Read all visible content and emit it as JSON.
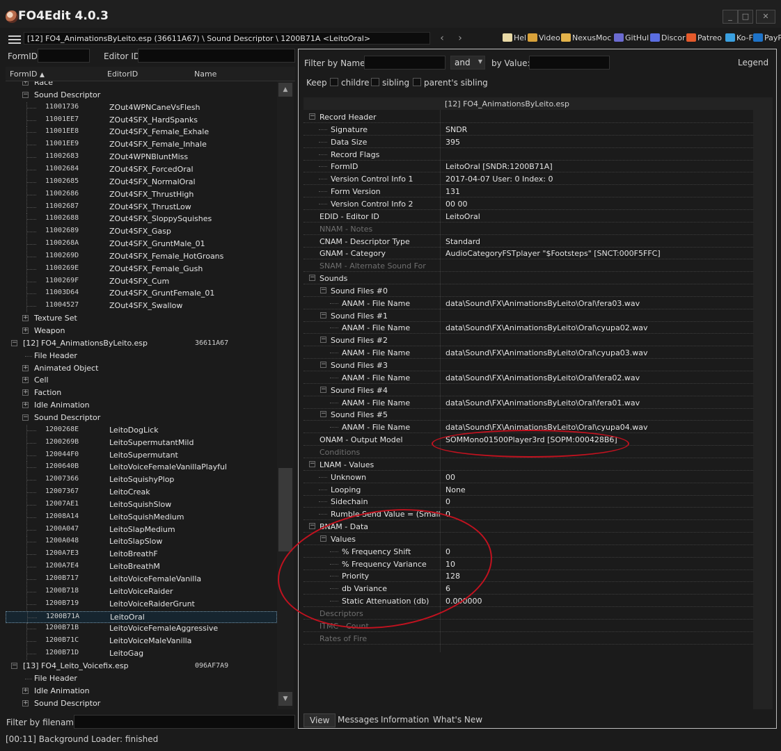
{
  "window": {
    "title": "FO4Edit 4.0.3",
    "min_glyph": "_",
    "max_glyph": "□",
    "close_glyph": "✕"
  },
  "toolbar": {
    "path": "[12] FO4_AnimationsByLeito.esp (36611A67) \\ Sound Descriptor \\ 1200B71A <LeitoOral>",
    "back_glyph": "‹",
    "forward_glyph": "›",
    "links": [
      "Hel",
      "Video",
      "NexusMoc",
      "GitHul",
      "Discor",
      "Patreo",
      "Ko-F",
      "PayPa"
    ]
  },
  "left": {
    "formid_label": "FormID",
    "editorid_label": "Editor ID",
    "columns": [
      "FormID",
      "EditorID",
      "Name"
    ],
    "sort_glyph": "▲",
    "filter_label": "Filter by filename:",
    "tree": [
      {
        "kind": "group",
        "level": 2,
        "text": "Race",
        "exp": "+"
      },
      {
        "kind": "group",
        "level": 2,
        "text": "Sound Descriptor",
        "exp": "−"
      },
      {
        "kind": "rec",
        "id": "11001736",
        "ed": "ZOut4WPNCaneVsFlesh"
      },
      {
        "kind": "rec",
        "id": "11001EE7",
        "ed": "ZOut4SFX_HardSpanks"
      },
      {
        "kind": "rec",
        "id": "11001EE8",
        "ed": "ZOut4SFX_Female_Exhale"
      },
      {
        "kind": "rec",
        "id": "11001EE9",
        "ed": "ZOut4SFX_Female_Inhale"
      },
      {
        "kind": "rec",
        "id": "11002683",
        "ed": "ZOut4WPNBluntMiss"
      },
      {
        "kind": "rec",
        "id": "11002684",
        "ed": "ZOut4SFX_ForcedOral"
      },
      {
        "kind": "rec",
        "id": "11002685",
        "ed": "ZOut4SFX_NormalOral"
      },
      {
        "kind": "rec",
        "id": "11002686",
        "ed": "ZOut4SFX_ThrustHigh"
      },
      {
        "kind": "rec",
        "id": "11002687",
        "ed": "ZOut4SFX_ThrustLow"
      },
      {
        "kind": "rec",
        "id": "11002688",
        "ed": "ZOut4SFX_SloppySquishes"
      },
      {
        "kind": "rec",
        "id": "11002689",
        "ed": "ZOut4SFX_Gasp"
      },
      {
        "kind": "rec",
        "id": "1100268A",
        "ed": "ZOut4SFX_GruntMale_01"
      },
      {
        "kind": "rec",
        "id": "1100269D",
        "ed": "ZOut4SFX_Female_HotGroans"
      },
      {
        "kind": "rec",
        "id": "1100269E",
        "ed": "ZOut4SFX_Female_Gush"
      },
      {
        "kind": "rec",
        "id": "1100269F",
        "ed": "ZOut4SFX_Cum"
      },
      {
        "kind": "rec",
        "id": "11003D64",
        "ed": "ZOut4SFX_GruntFemale_01"
      },
      {
        "kind": "rec",
        "id": "11004527",
        "ed": "ZOut4SFX_Swallow"
      },
      {
        "kind": "group",
        "level": 2,
        "text": "Texture Set",
        "exp": "+"
      },
      {
        "kind": "group",
        "level": 2,
        "text": "Weapon",
        "exp": "+"
      },
      {
        "kind": "file",
        "text": "[12] FO4_AnimationsByLeito.esp",
        "fid": "36611A67",
        "exp": "−"
      },
      {
        "kind": "group",
        "level": 2,
        "text": "File Header",
        "exp": ""
      },
      {
        "kind": "group",
        "level": 2,
        "text": "Animated Object",
        "exp": "+"
      },
      {
        "kind": "group",
        "level": 2,
        "text": "Cell",
        "exp": "+"
      },
      {
        "kind": "group",
        "level": 2,
        "text": "Faction",
        "exp": "+"
      },
      {
        "kind": "group",
        "level": 2,
        "text": "Idle Animation",
        "exp": "+"
      },
      {
        "kind": "group",
        "level": 2,
        "text": "Sound Descriptor",
        "exp": "−"
      },
      {
        "kind": "rec",
        "id": "1200268E",
        "ed": "LeitoDogLick"
      },
      {
        "kind": "rec",
        "id": "1200269B",
        "ed": "LeitoSupermutantMild"
      },
      {
        "kind": "rec",
        "id": "120044F0",
        "ed": "LeitoSupermutant"
      },
      {
        "kind": "rec",
        "id": "1200640B",
        "ed": "LeitoVoiceFemaleVanillaPlayful"
      },
      {
        "kind": "rec",
        "id": "12007366",
        "ed": "LeitoSquishyPlop"
      },
      {
        "kind": "rec",
        "id": "12007367",
        "ed": "LeitoCreak"
      },
      {
        "kind": "rec",
        "id": "12007AE1",
        "ed": "LeitoSquishSlow"
      },
      {
        "kind": "rec",
        "id": "12008A14",
        "ed": "LeitoSquishMedium"
      },
      {
        "kind": "rec",
        "id": "1200A047",
        "ed": "LeitoSlapMedium"
      },
      {
        "kind": "rec",
        "id": "1200A048",
        "ed": "LeitoSlapSlow"
      },
      {
        "kind": "rec",
        "id": "1200A7E3",
        "ed": "LeitoBreathF"
      },
      {
        "kind": "rec",
        "id": "1200A7E4",
        "ed": "LeitoBreathM"
      },
      {
        "kind": "rec",
        "id": "1200B717",
        "ed": "LeitoVoiceFemaleVanilla"
      },
      {
        "kind": "rec",
        "id": "1200B718",
        "ed": "LeitoVoiceRaider"
      },
      {
        "kind": "rec",
        "id": "1200B719",
        "ed": "LeitoVoiceRaiderGrunt"
      },
      {
        "kind": "rec",
        "id": "1200B71A",
        "ed": "LeitoOral",
        "selected": true
      },
      {
        "kind": "rec",
        "id": "1200B71B",
        "ed": "LeitoVoiceFemaleAggressive"
      },
      {
        "kind": "rec",
        "id": "1200B71C",
        "ed": "LeitoVoiceMaleVanilla"
      },
      {
        "kind": "rec",
        "id": "1200B71D",
        "ed": "LeitoGag"
      },
      {
        "kind": "file",
        "text": "[13] FO4_Leito_Voicefix.esp",
        "fid": "096AF7A9",
        "exp": "−"
      },
      {
        "kind": "group",
        "level": 2,
        "text": "File Header",
        "exp": ""
      },
      {
        "kind": "group",
        "level": 2,
        "text": "Idle Animation",
        "exp": "+"
      },
      {
        "kind": "group",
        "level": 2,
        "text": "Sound Descriptor",
        "exp": "+"
      }
    ]
  },
  "right": {
    "filter_name_label": "Filter by Name:",
    "and_label": "and",
    "by_value_label": "by Value:",
    "legend": "Legend",
    "keep_label": "Keep",
    "keep_opts": [
      "childre",
      "sibling",
      "parent's sibling"
    ],
    "column_header": "[12] FO4_AnimationsByLeito.esp",
    "rows": [
      {
        "lvl": 0,
        "exp": "−",
        "name": "Record Header",
        "val": ""
      },
      {
        "lvl": 1,
        "exp": "",
        "name": "Signature",
        "val": "SNDR"
      },
      {
        "lvl": 1,
        "exp": "",
        "name": "Data Size",
        "val": "395"
      },
      {
        "lvl": 1,
        "exp": "",
        "name": "Record Flags",
        "val": ""
      },
      {
        "lvl": 1,
        "exp": "",
        "name": "FormID",
        "val": "LeitoOral [SNDR:1200B71A]"
      },
      {
        "lvl": 1,
        "exp": "",
        "name": "Version Control Info 1",
        "val": "2017-04-07 User: 0 Index: 0"
      },
      {
        "lvl": 1,
        "exp": "",
        "name": "Form Version",
        "val": "131"
      },
      {
        "lvl": 1,
        "exp": "",
        "name": "Version Control Info 2",
        "val": "00 00"
      },
      {
        "lvl": 0,
        "exp": "",
        "name": "EDID - Editor ID",
        "val": "LeitoOral"
      },
      {
        "lvl": 0,
        "exp": "",
        "name": "NNAM - Notes",
        "val": "",
        "dim": true
      },
      {
        "lvl": 0,
        "exp": "",
        "name": "CNAM - Descriptor Type",
        "val": "Standard"
      },
      {
        "lvl": 0,
        "exp": "",
        "name": "GNAM - Category",
        "val": "AudioCategoryFSTplayer \"$Footsteps\" [SNCT:000F5FFC]"
      },
      {
        "lvl": 0,
        "exp": "",
        "name": "SNAM - Alternate Sound For",
        "val": "",
        "dim": true
      },
      {
        "lvl": 0,
        "exp": "−",
        "name": "Sounds",
        "val": ""
      },
      {
        "lvl": 1,
        "exp": "−",
        "name": "Sound Files #0",
        "val": ""
      },
      {
        "lvl": 2,
        "exp": "",
        "name": "ANAM - File Name",
        "val": "data\\Sound\\FX\\AnimationsByLeito\\Oral\\fera03.wav"
      },
      {
        "lvl": 1,
        "exp": "−",
        "name": "Sound Files #1",
        "val": ""
      },
      {
        "lvl": 2,
        "exp": "",
        "name": "ANAM - File Name",
        "val": "data\\Sound\\FX\\AnimationsByLeito\\Oral\\cyupa02.wav"
      },
      {
        "lvl": 1,
        "exp": "−",
        "name": "Sound Files #2",
        "val": ""
      },
      {
        "lvl": 2,
        "exp": "",
        "name": "ANAM - File Name",
        "val": "data\\Sound\\FX\\AnimationsByLeito\\Oral\\cyupa03.wav"
      },
      {
        "lvl": 1,
        "exp": "−",
        "name": "Sound Files #3",
        "val": ""
      },
      {
        "lvl": 2,
        "exp": "",
        "name": "ANAM - File Name",
        "val": "data\\Sound\\FX\\AnimationsByLeito\\Oral\\fera02.wav"
      },
      {
        "lvl": 1,
        "exp": "−",
        "name": "Sound Files #4",
        "val": ""
      },
      {
        "lvl": 2,
        "exp": "",
        "name": "ANAM - File Name",
        "val": "data\\Sound\\FX\\AnimationsByLeito\\Oral\\fera01.wav"
      },
      {
        "lvl": 1,
        "exp": "−",
        "name": "Sound Files #5",
        "val": ""
      },
      {
        "lvl": 2,
        "exp": "",
        "name": "ANAM - File Name",
        "val": "data\\Sound\\FX\\AnimationsByLeito\\Oral\\cyupa04.wav"
      },
      {
        "lvl": 0,
        "exp": "",
        "name": "ONAM - Output Model",
        "val": "SOMMono01500Player3rd [SOPM:000428B6]"
      },
      {
        "lvl": 0,
        "exp": "",
        "name": "Conditions",
        "val": "",
        "dim": true
      },
      {
        "lvl": 0,
        "exp": "−",
        "name": "LNAM - Values",
        "val": ""
      },
      {
        "lvl": 1,
        "exp": "",
        "name": "Unknown",
        "val": "00"
      },
      {
        "lvl": 1,
        "exp": "",
        "name": "Looping",
        "val": "None"
      },
      {
        "lvl": 1,
        "exp": "",
        "name": "Sidechain",
        "val": "0"
      },
      {
        "lvl": 1,
        "exp": "",
        "name": "Rumble Send Value = (Small",
        "val": "0"
      },
      {
        "lvl": 0,
        "exp": "−",
        "name": "BNAM - Data",
        "val": ""
      },
      {
        "lvl": 1,
        "exp": "−",
        "name": "Values",
        "val": ""
      },
      {
        "lvl": 2,
        "exp": "",
        "name": "% Frequency Shift",
        "val": "0"
      },
      {
        "lvl": 2,
        "exp": "",
        "name": "% Frequency Variance",
        "val": "10"
      },
      {
        "lvl": 2,
        "exp": "",
        "name": "Priority",
        "val": "128"
      },
      {
        "lvl": 2,
        "exp": "",
        "name": "db Variance",
        "val": "6"
      },
      {
        "lvl": 2,
        "exp": "",
        "name": "Static Attenuation (db)",
        "val": "0.000000"
      },
      {
        "lvl": 0,
        "exp": "",
        "name": "Descriptors",
        "val": "",
        "dim": true
      },
      {
        "lvl": 0,
        "exp": "",
        "name": "ITMC - Count",
        "val": "",
        "dim": true
      },
      {
        "lvl": 0,
        "exp": "",
        "name": "Rates of Fire",
        "val": "",
        "dim": true
      }
    ],
    "tabs": [
      "View",
      "Messages",
      "Information",
      "What's New"
    ]
  },
  "status": "[00:11] Background Loader: finished",
  "colors": {
    "highlight": "#c1121f",
    "selection": "#16252f"
  }
}
